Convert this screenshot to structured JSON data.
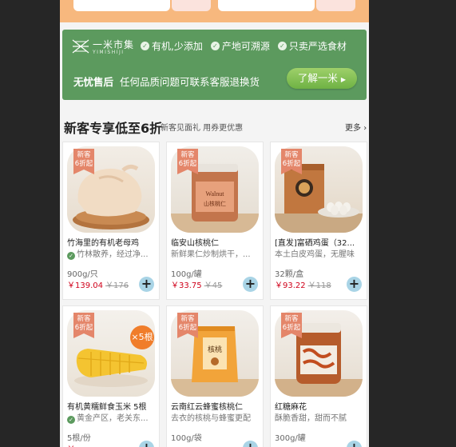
{
  "brand": {
    "name": "一米市集",
    "sub": "YIMISHIJI"
  },
  "features": [
    "有机,少添加",
    "产地可溯源",
    "只卖严选食材"
  ],
  "service": {
    "title": "无忧售后",
    "text": "任何品质问题可联系客服退换货"
  },
  "learn_more": "了解一米",
  "section": {
    "title": "新客专享低至6折",
    "subtitle": "新客见面礼 用券更优惠",
    "more": "更多"
  },
  "tag": {
    "line1": "新客",
    "line2": "6折起"
  },
  "products": [
    {
      "name": "竹海里的有机老母鸡",
      "desc": "竹林散养，经过净...",
      "desc_icon": true,
      "spec": "900g/只",
      "price": "￥139.04",
      "old_price": "￥176",
      "image": "chicken-image"
    },
    {
      "name": "临安山核桃仁",
      "desc": "新鲜果仁炒制烘干，...",
      "desc_icon": false,
      "spec": "100g/罐",
      "price": "￥33.75",
      "old_price": "￥45",
      "image": "walnut-jar-image"
    },
    {
      "name": "[直发]富硒鸡蛋（32...",
      "desc": "本土白皮鸡蛋，无腥味",
      "desc_icon": false,
      "spec": "32颗/盒",
      "price": "￥93.22",
      "old_price": "￥118",
      "image": "eggs-box-image"
    },
    {
      "name": "有机黄糯鲜食玉米 5根",
      "desc": "黄金产区，老关东...",
      "desc_icon": true,
      "spec": "5根/份",
      "price": "￥",
      "old_price": "",
      "image": "corn-image",
      "badge": "×5根"
    },
    {
      "name": "云南红云蜂蜜核桃仁",
      "desc": "去衣的核桃与蜂蜜更配",
      "desc_icon": false,
      "spec": "100g/袋",
      "price": "",
      "old_price": "",
      "image": "honey-walnut-bag-image"
    },
    {
      "name": "红糖麻花",
      "desc": "酥脆香甜，甜而不腻",
      "desc_icon": false,
      "spec": "300g/罐",
      "price": "",
      "old_price": "",
      "image": "mahua-jar-image"
    }
  ],
  "colors": {
    "banner": "#5c9a5e",
    "accent": "#d0021b",
    "tag": "#e4866a",
    "top_strip": "#f7b87e"
  }
}
